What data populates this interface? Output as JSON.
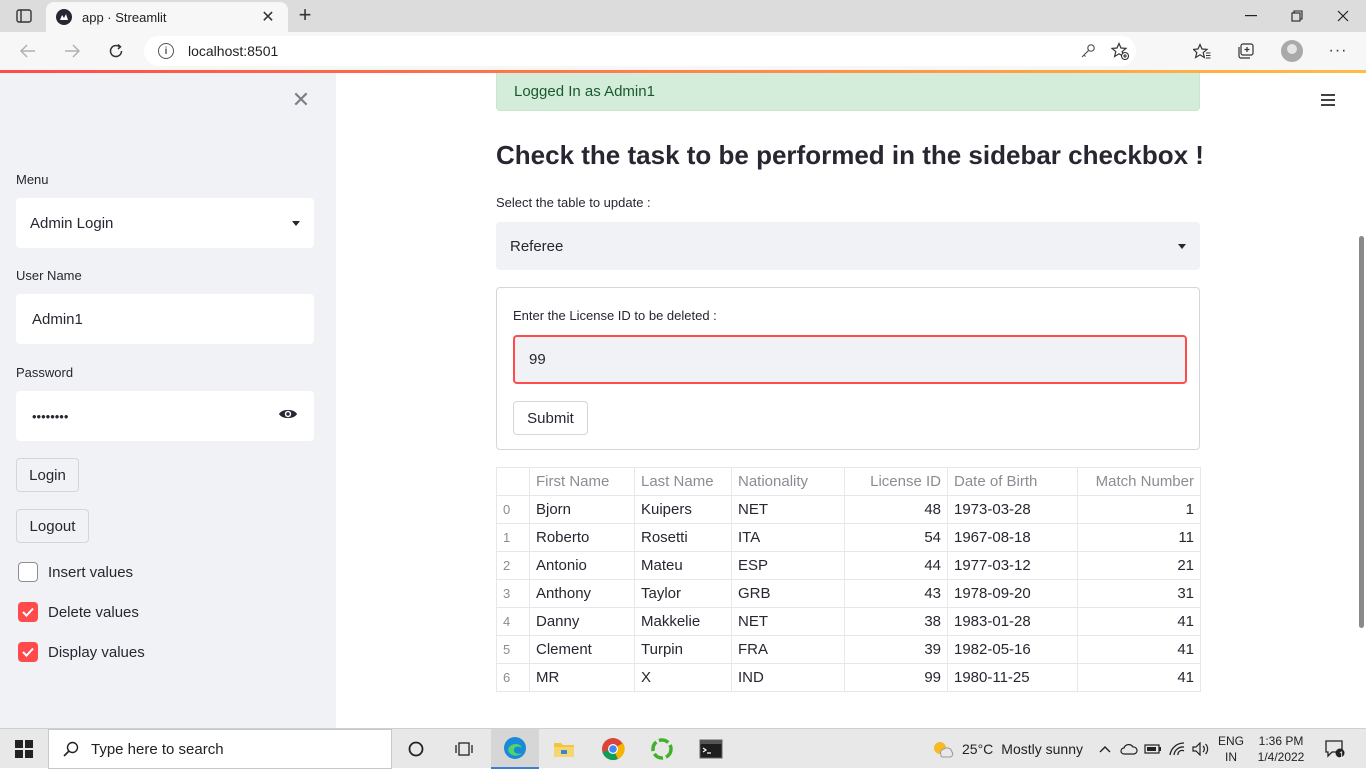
{
  "browser": {
    "tab_title": "app · Streamlit",
    "url": "localhost:8501"
  },
  "sidebar": {
    "menu_label": "Menu",
    "menu_value": "Admin Login",
    "username_label": "User Name",
    "username_value": "Admin1",
    "password_label": "Password",
    "password_value": "••••••••",
    "login_label": "Login",
    "logout_label": "Logout",
    "checkboxes": [
      {
        "label": "Insert values",
        "checked": false
      },
      {
        "label": "Delete values",
        "checked": true
      },
      {
        "label": "Display values",
        "checked": true
      }
    ]
  },
  "main": {
    "alert": "Logged In as Admin1",
    "heading": "Check the task to be performed in the sidebar checkbox !",
    "table_select_label": "Select the table to update :",
    "table_select_value": "Referee",
    "form": {
      "label": "Enter the License ID to be deleted :",
      "value": "99",
      "submit_label": "Submit"
    },
    "table": {
      "columns": [
        "First Name",
        "Last Name",
        "Nationality",
        "License ID",
        "Date of Birth",
        "Match Number"
      ],
      "rows": [
        [
          "0",
          "Bjorn",
          "Kuipers",
          "NET",
          "48",
          "1973-03-28",
          "1"
        ],
        [
          "1",
          "Roberto",
          "Rosetti",
          "ITA",
          "54",
          "1967-08-18",
          "11"
        ],
        [
          "2",
          "Antonio",
          "Mateu",
          "ESP",
          "44",
          "1977-03-12",
          "21"
        ],
        [
          "3",
          "Anthony",
          "Taylor",
          "GRB",
          "43",
          "1978-09-20",
          "31"
        ],
        [
          "4",
          "Danny",
          "Makkelie",
          "NET",
          "38",
          "1983-01-28",
          "41"
        ],
        [
          "5",
          "Clement",
          "Turpin",
          "FRA",
          "39",
          "1982-05-16",
          "41"
        ],
        [
          "6",
          "MR",
          "X",
          "IND",
          "99",
          "1980-11-25",
          "41"
        ]
      ]
    }
  },
  "taskbar": {
    "search_placeholder": "Type here to search",
    "weather_temp": "25°C",
    "weather_desc": "Mostly sunny",
    "lang_top": "ENG",
    "lang_bottom": "IN",
    "time": "1:36 PM",
    "date": "1/4/2022",
    "notification_count": "1"
  },
  "colors": {
    "accent": "#ff4b4b",
    "sidebar_bg": "#f0f2f6",
    "alert_bg": "#d4edda",
    "alert_text": "#185b2b"
  }
}
